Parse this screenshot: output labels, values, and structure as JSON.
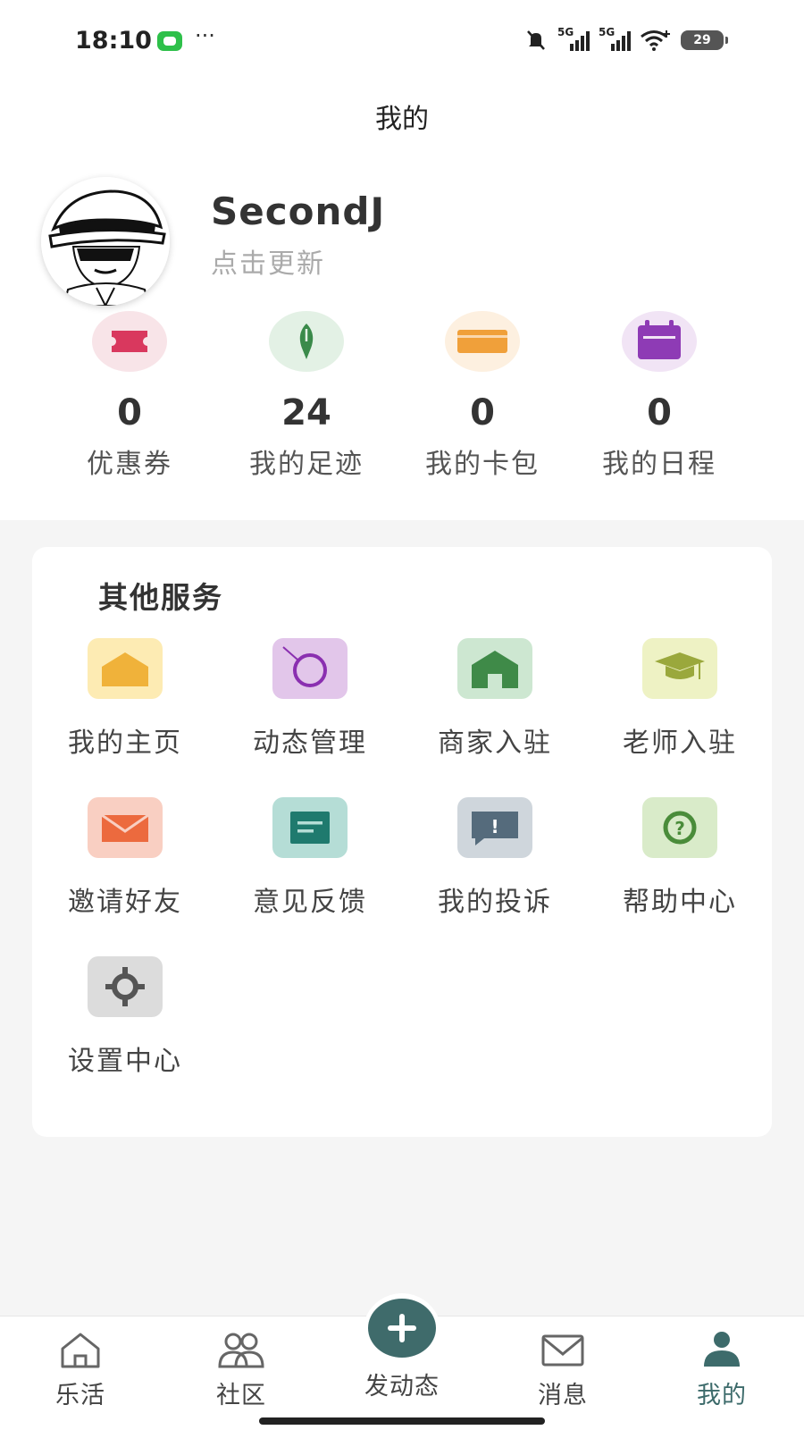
{
  "status_bar": {
    "time": "18:10",
    "dots": "···",
    "network_1": "5G",
    "network_2": "5G",
    "battery": "29"
  },
  "header": {
    "title": "我的"
  },
  "profile": {
    "username": "SecondJ",
    "update_link": "点击更新"
  },
  "stats": [
    {
      "icon": "ticket-icon",
      "value": "0",
      "label": "优惠券",
      "color": "#d9385e"
    },
    {
      "icon": "sprout-icon",
      "value": "24",
      "label": "我的足迹",
      "color": "#3a8a4a"
    },
    {
      "icon": "card-icon",
      "value": "0",
      "label": "我的卡包",
      "color": "#f0a03a"
    },
    {
      "icon": "calendar-icon",
      "value": "0",
      "label": "我的日程",
      "color": "#8e3bb5"
    }
  ],
  "services": {
    "title": "其他服务",
    "items": [
      {
        "icon": "house-icon",
        "label": "我的主页"
      },
      {
        "icon": "ring-icon",
        "label": "动态管理"
      },
      {
        "icon": "shop-icon",
        "label": "商家入驻"
      },
      {
        "icon": "mortarboard-icon",
        "label": "老师入驻"
      },
      {
        "icon": "mail-icon",
        "label": "邀请好友"
      },
      {
        "icon": "note-icon",
        "label": "意见反馈"
      },
      {
        "icon": "alert-chat-icon",
        "label": "我的投诉",
        "glyph": "!"
      },
      {
        "icon": "help-icon",
        "label": "帮助中心",
        "glyph": "?"
      },
      {
        "icon": "settings-icon",
        "label": "设置中心"
      }
    ]
  },
  "tabbar": {
    "items": [
      {
        "icon": "home-icon",
        "label": "乐活"
      },
      {
        "icon": "community-icon",
        "label": "社区"
      },
      {
        "icon": "plus-icon",
        "label": "发动态"
      },
      {
        "icon": "envelope-icon",
        "label": "消息"
      },
      {
        "icon": "person-icon",
        "label": "我的",
        "active": true
      }
    ],
    "active_color": "#3d6b6b"
  }
}
